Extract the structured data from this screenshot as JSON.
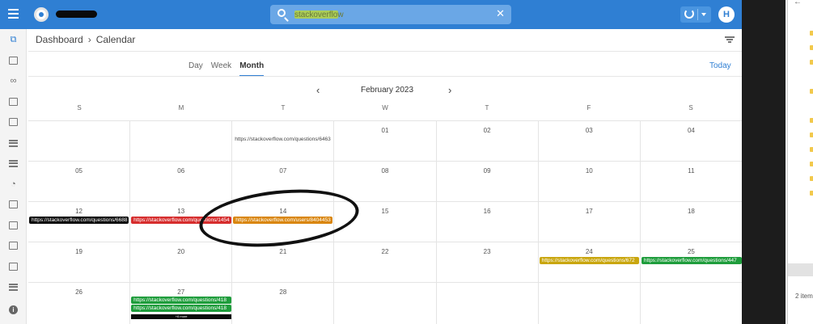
{
  "header": {
    "search": {
      "value": "stackoverflow",
      "placeholder": ""
    },
    "avatar_initial": "H"
  },
  "breadcrumb": {
    "root": "Dashboard",
    "separator": "›",
    "current": "Calendar"
  },
  "views": {
    "day": "Day",
    "week": "Week",
    "month": "Month",
    "active": "Month"
  },
  "today_label": "Today",
  "calendar": {
    "month": "February 2023",
    "weekdays": [
      "S",
      "M",
      "T",
      "W",
      "T",
      "F",
      "S"
    ],
    "weeks": [
      [
        "",
        "",
        "",
        "01",
        "02",
        "03",
        "04"
      ],
      [
        "05",
        "06",
        "07",
        "08",
        "09",
        "10",
        "11"
      ],
      [
        "12",
        "13",
        "14",
        "15",
        "16",
        "17",
        "18"
      ],
      [
        "19",
        "20",
        "21",
        "22",
        "23",
        "24",
        "25"
      ],
      [
        "26",
        "27",
        "28",
        "",
        "",
        "",
        ""
      ]
    ],
    "events": {
      "w1_tue": "https://stackoverflow.com/questions/6463",
      "w3_sun": "https://stackoverflow.com/questions/6688",
      "w3_mon": "https://stackoverflow.com/questions/1454",
      "w3_tue": "https://stackoverflow.com/users/8404453",
      "w4_fri": "https://stackoverflow.com/questions/672",
      "w4_sat": "https://stackoverflow.com/questions/447",
      "w5_mon_1": "https://stackoverflow.com/questions/418",
      "w5_mon_2": "https://stackoverflow.com/questions/418",
      "w5_mon_more": "+6 more"
    },
    "colors": {
      "black": "#0a0a0a",
      "red": "#d62d2d",
      "orange": "#d9860f",
      "gold": "#c9a60e",
      "green": "#1f9d3c"
    }
  },
  "right_panel": {
    "back": "←",
    "items_count": "2 item"
  }
}
